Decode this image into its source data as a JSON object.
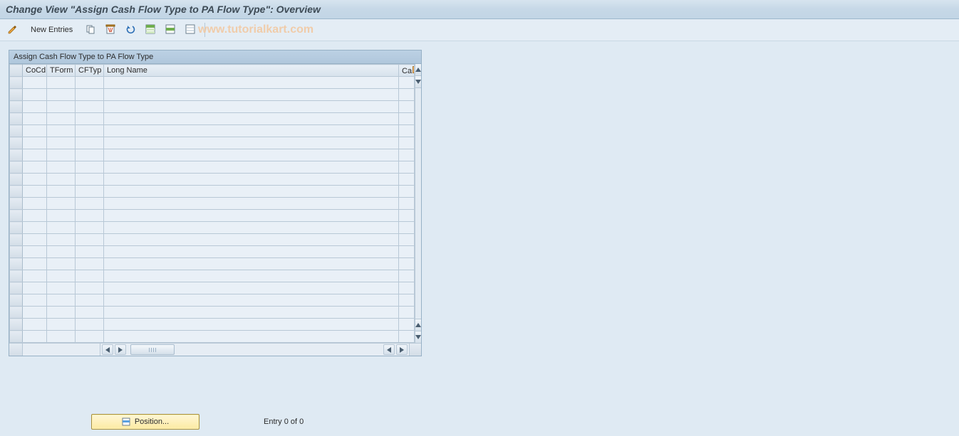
{
  "header": {
    "title": "Change View \"Assign Cash Flow Type to PA Flow Type\": Overview"
  },
  "toolbar": {
    "new_entries_label": "New Entries"
  },
  "watermark": "www.tutorialkart.com",
  "table": {
    "title": "Assign Cash Flow Type to PA Flow Type",
    "columns": {
      "cocd": "CoCd",
      "tform": "TForm",
      "cftyp": "CFTyp",
      "long_name": "Long Name",
      "extra": "Ca"
    },
    "rows": [
      {
        "cocd": "",
        "tform": "",
        "cftyp": "",
        "long_name": "",
        "extra": ""
      },
      {
        "cocd": "",
        "tform": "",
        "cftyp": "",
        "long_name": "",
        "extra": ""
      },
      {
        "cocd": "",
        "tform": "",
        "cftyp": "",
        "long_name": "",
        "extra": ""
      },
      {
        "cocd": "",
        "tform": "",
        "cftyp": "",
        "long_name": "",
        "extra": ""
      },
      {
        "cocd": "",
        "tform": "",
        "cftyp": "",
        "long_name": "",
        "extra": ""
      },
      {
        "cocd": "",
        "tform": "",
        "cftyp": "",
        "long_name": "",
        "extra": ""
      },
      {
        "cocd": "",
        "tform": "",
        "cftyp": "",
        "long_name": "",
        "extra": ""
      },
      {
        "cocd": "",
        "tform": "",
        "cftyp": "",
        "long_name": "",
        "extra": ""
      },
      {
        "cocd": "",
        "tform": "",
        "cftyp": "",
        "long_name": "",
        "extra": ""
      },
      {
        "cocd": "",
        "tform": "",
        "cftyp": "",
        "long_name": "",
        "extra": ""
      },
      {
        "cocd": "",
        "tform": "",
        "cftyp": "",
        "long_name": "",
        "extra": ""
      },
      {
        "cocd": "",
        "tform": "",
        "cftyp": "",
        "long_name": "",
        "extra": ""
      },
      {
        "cocd": "",
        "tform": "",
        "cftyp": "",
        "long_name": "",
        "extra": ""
      },
      {
        "cocd": "",
        "tform": "",
        "cftyp": "",
        "long_name": "",
        "extra": ""
      },
      {
        "cocd": "",
        "tform": "",
        "cftyp": "",
        "long_name": "",
        "extra": ""
      },
      {
        "cocd": "",
        "tform": "",
        "cftyp": "",
        "long_name": "",
        "extra": ""
      },
      {
        "cocd": "",
        "tform": "",
        "cftyp": "",
        "long_name": "",
        "extra": ""
      },
      {
        "cocd": "",
        "tform": "",
        "cftyp": "",
        "long_name": "",
        "extra": ""
      },
      {
        "cocd": "",
        "tform": "",
        "cftyp": "",
        "long_name": "",
        "extra": ""
      },
      {
        "cocd": "",
        "tform": "",
        "cftyp": "",
        "long_name": "",
        "extra": ""
      },
      {
        "cocd": "",
        "tform": "",
        "cftyp": "",
        "long_name": "",
        "extra": ""
      },
      {
        "cocd": "",
        "tform": "",
        "cftyp": "",
        "long_name": "",
        "extra": ""
      }
    ]
  },
  "footer": {
    "position_label": "Position...",
    "entry_label": "Entry 0 of 0"
  }
}
